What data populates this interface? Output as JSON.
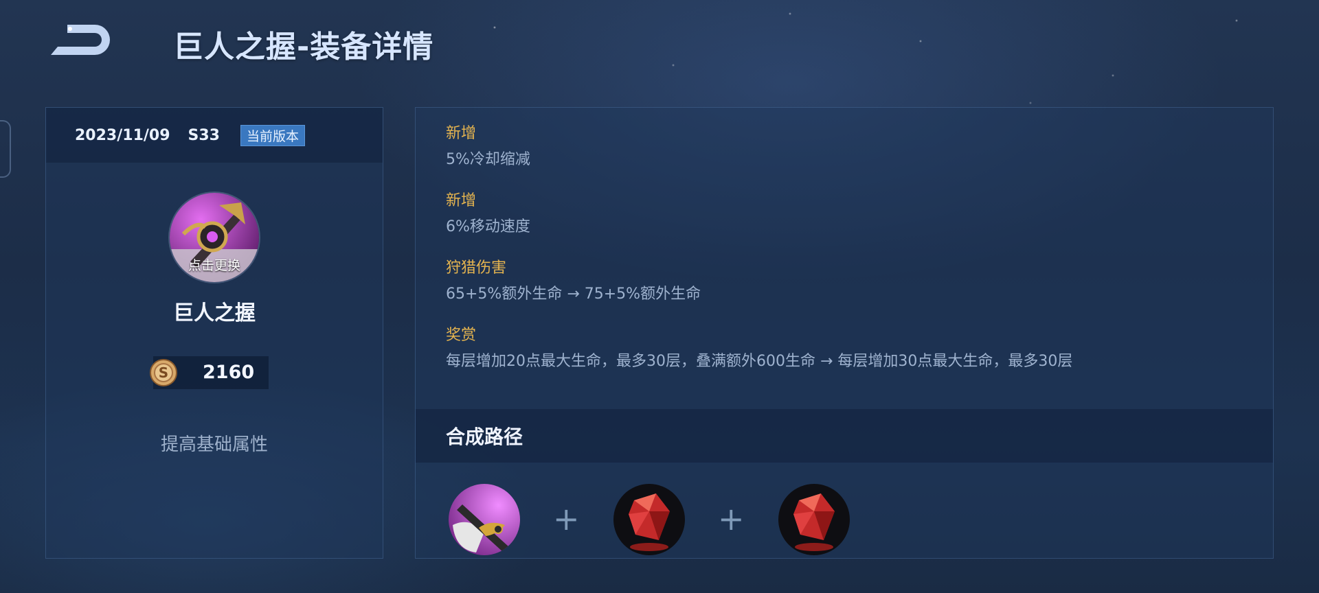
{
  "header": {
    "title": "巨人之握-装备详情",
    "back_icon": "back-arrow-icon"
  },
  "version": {
    "date": "2023/11/09",
    "season": "S33",
    "badge": "当前版本"
  },
  "item": {
    "icon": "giant-grip-icon",
    "change_label": "点击更换",
    "name": "巨人之握",
    "price_icon": "gold-coin-icon",
    "price": "2160",
    "description": "提高基础属性"
  },
  "changes": [
    {
      "title": "新增",
      "text": "5%冷却缩减"
    },
    {
      "title": "新增",
      "text": "6%移动速度"
    },
    {
      "title": "狩猎伤害",
      "text": "65+5%额外生命 → 75+5%额外生命"
    },
    {
      "title": "奖赏",
      "text": "每层增加20点最大生命，最多30层，叠满额外600生命 → 每层增加30点最大生命，最多30层"
    }
  ],
  "recipe": {
    "title": "合成路径",
    "plus": "+",
    "items": [
      {
        "icon": "axe-item-icon"
      },
      {
        "icon": "red-crystal-icon"
      },
      {
        "icon": "red-crystal-icon"
      }
    ]
  },
  "colors": {
    "accent_gold": "#e5b44f",
    "badge_blue": "#3a78c0",
    "bg": "#1f3150"
  }
}
